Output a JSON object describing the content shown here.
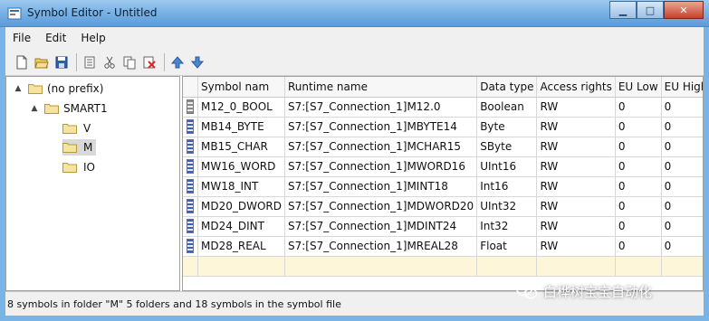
{
  "window": {
    "title": "Symbol Editor - Untitled",
    "minimize_glyph": "▁",
    "maximize_glyph": "□",
    "close_glyph": "✕"
  },
  "menu": [
    "File",
    "Edit",
    "Help"
  ],
  "toolbar": {
    "buttons": [
      "new-icon",
      "open-icon",
      "save-icon",
      "properties-icon",
      "cut-icon",
      "copy-icon",
      "delete-icon",
      "move-up-icon",
      "move-down-icon"
    ]
  },
  "tree": {
    "nodes": [
      {
        "label": "(no prefix)",
        "toggle": "▲"
      },
      {
        "label": "SMART1",
        "toggle": "▲"
      },
      {
        "label": "V",
        "toggle": ""
      },
      {
        "label": "M",
        "toggle": ""
      },
      {
        "label": "IO",
        "toggle": ""
      }
    ],
    "selected": "M"
  },
  "table": {
    "columns": [
      "Symbol nam",
      "Runtime name",
      "Data type",
      "Access rights",
      "EU Low",
      "EU High"
    ],
    "rows": [
      [
        "M12_0_BOOL",
        "S7:[S7_Connection_1]M12.0",
        "Boolean",
        "RW",
        "0",
        "0"
      ],
      [
        "MB14_BYTE",
        "S7:[S7_Connection_1]MBYTE14",
        "Byte",
        "RW",
        "0",
        "0"
      ],
      [
        "MB15_CHAR",
        "S7:[S7_Connection_1]MCHAR15",
        "SByte",
        "RW",
        "0",
        "0"
      ],
      [
        "MW16_WORD",
        "S7:[S7_Connection_1]MWORD16",
        "UInt16",
        "RW",
        "0",
        "0"
      ],
      [
        "MW18_INT",
        "S7:[S7_Connection_1]MINT18",
        "Int16",
        "RW",
        "0",
        "0"
      ],
      [
        "MD20_DWORD",
        "S7:[S7_Connection_1]MDWORD20",
        "UInt32",
        "RW",
        "0",
        "0"
      ],
      [
        "MD24_DINT",
        "S7:[S7_Connection_1]MDINT24",
        "Int32",
        "RW",
        "0",
        "0"
      ],
      [
        "MD28_REAL",
        "S7:[S7_Connection_1]MREAL28",
        "Float",
        "RW",
        "0",
        "0"
      ]
    ]
  },
  "status": {
    "text": "8 symbols in folder \"M\"  5 folders and 18 symbols in the symbol file"
  },
  "watermark": {
    "text": "白桦树宝宝自动化"
  },
  "colors": {
    "titlebar": "#7ab3e6",
    "folder": "#f5e4a0",
    "selected_tree": "#d9d9d9",
    "new_row": "#fdf6d8"
  }
}
